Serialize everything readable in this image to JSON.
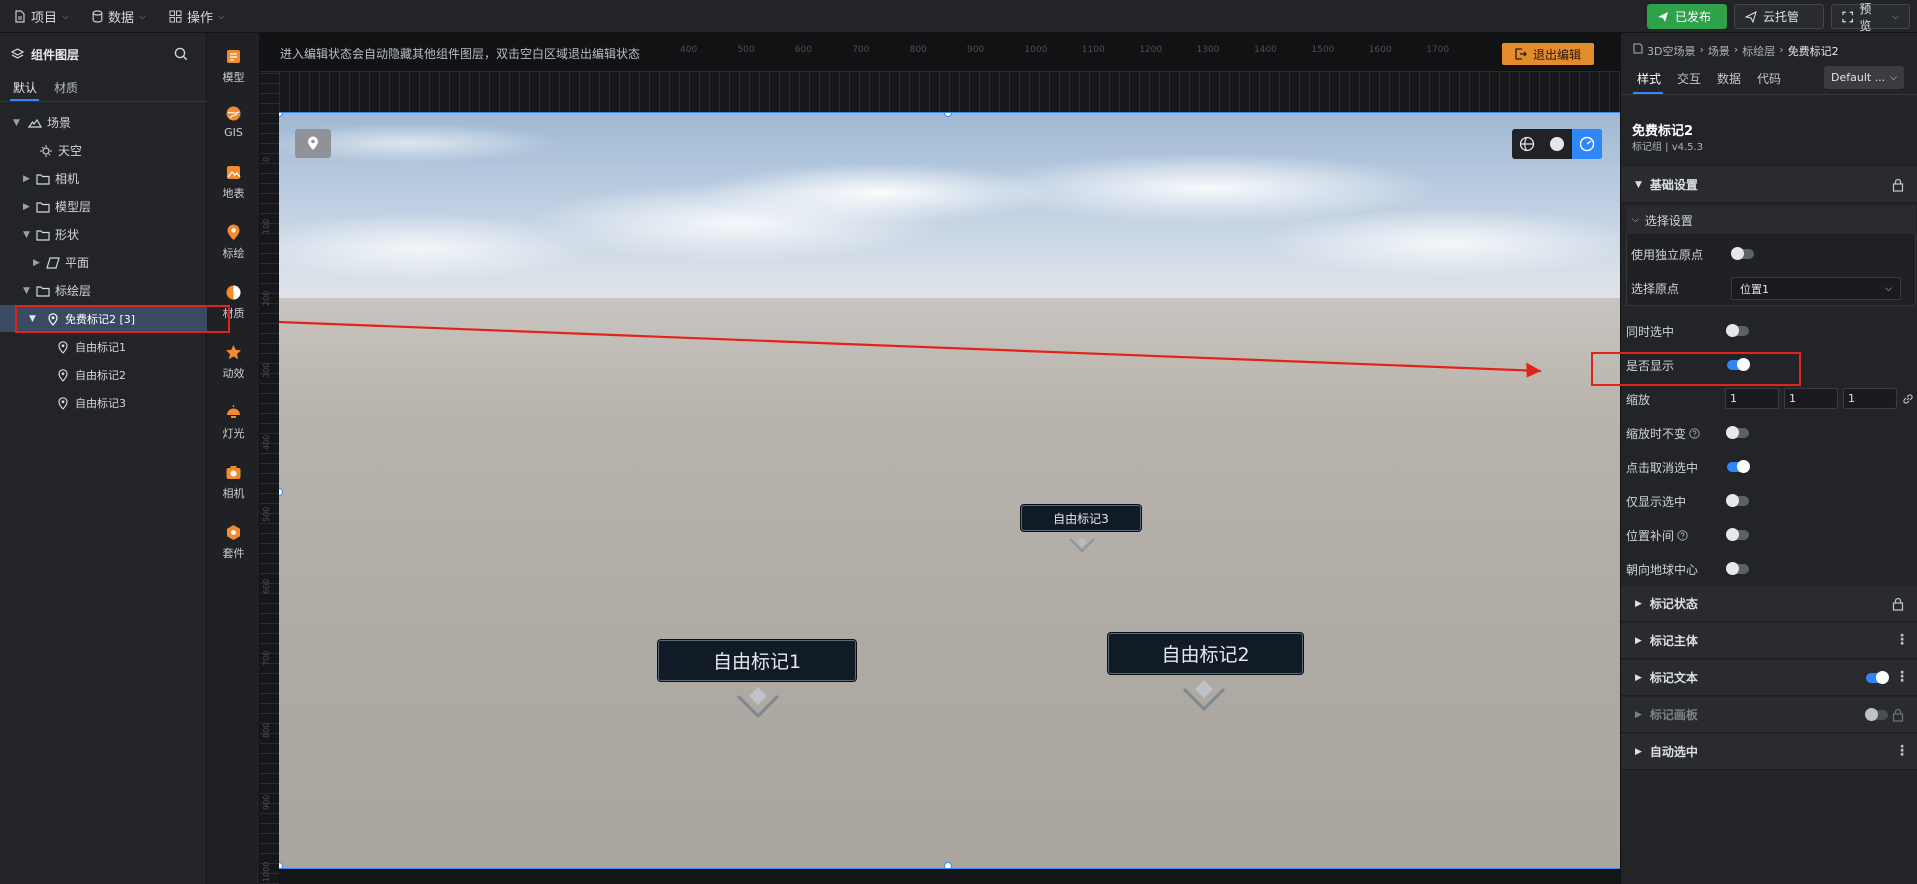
{
  "topbar": {
    "menus": [
      {
        "label": "项目",
        "icon": "file-icon"
      },
      {
        "label": "数据",
        "icon": "database-icon"
      },
      {
        "label": "操作",
        "icon": "grid-icon"
      }
    ],
    "buttons": {
      "publish": "已发布",
      "cloud": "云托管",
      "preview": "预览"
    },
    "colors": {
      "publish": "#2fa14b",
      "accent": "#2f86f6"
    }
  },
  "left_panel": {
    "title": "组件图层",
    "tabs": [
      "默认",
      "材质"
    ],
    "tree": [
      {
        "label": "场景"
      },
      {
        "label": "天空"
      },
      {
        "label": "相机"
      },
      {
        "label": "模型层"
      },
      {
        "label": "形状"
      },
      {
        "label": "平面"
      },
      {
        "label": "标绘层"
      },
      {
        "label": "免费标记2 [3]"
      },
      {
        "label": "自由标记1"
      },
      {
        "label": "自由标记2"
      },
      {
        "label": "自由标记3"
      }
    ]
  },
  "toolbox": {
    "items": [
      {
        "label": "模型",
        "icon": "cube-icon"
      },
      {
        "label": "GIS",
        "icon": "globe-icon"
      },
      {
        "label": "地表",
        "icon": "terrain-icon"
      },
      {
        "label": "标绘",
        "icon": "pin-icon"
      },
      {
        "label": "材质",
        "icon": "material-icon"
      },
      {
        "label": "动效",
        "icon": "star-icon"
      },
      {
        "label": "灯光",
        "icon": "light-icon"
      },
      {
        "label": "相机",
        "icon": "camera-icon"
      },
      {
        "label": "套件",
        "icon": "kit-icon"
      }
    ]
  },
  "canvas": {
    "hint": "进入编辑状态会自动隐藏其他组件图层，双击空白区域退出编辑状态",
    "exit_label": "退出编辑",
    "ruler_top": [
      "400",
      "500",
      "600",
      "700",
      "800",
      "900",
      "1000",
      "1100",
      "1200",
      "1300",
      "1400",
      "1500",
      "1600",
      "1700"
    ],
    "ruler_left": [
      "0",
      "100",
      "200",
      "300",
      "400",
      "500",
      "600",
      "700",
      "800",
      "900",
      "1000"
    ],
    "markers": [
      {
        "label": "自由标记1"
      },
      {
        "label": "自由标记2"
      },
      {
        "label": "自由标记3"
      }
    ]
  },
  "right_panel": {
    "breadcrumb": [
      "3D空场景",
      "场景",
      "标绘层",
      "免费标记2"
    ],
    "tabs": [
      "样式",
      "交互",
      "数据",
      "代码"
    ],
    "theme_select": "Default ...",
    "component_name": "免费标记2",
    "component_subtitle": "标记组 | v4.5.3",
    "basic_section": "基础设置",
    "select_group": "选择设置",
    "props": {
      "use_origin": {
        "label": "使用独立原点",
        "on": false
      },
      "origin": {
        "label": "选择原点",
        "value": "位置1"
      },
      "multi_select": {
        "label": "同时选中",
        "on": false
      },
      "visible": {
        "label": "是否显示",
        "on": true
      },
      "scale": {
        "label": "缩放",
        "values": [
          "1",
          "1",
          "1"
        ]
      },
      "scale_fixed": {
        "label": "缩放时不变",
        "on": false
      },
      "click_deselect": {
        "label": "点击取消选中",
        "on": true
      },
      "show_selected_only": {
        "label": "仅显示选中",
        "on": false
      },
      "interpolate": {
        "label": "位置补间",
        "on": false
      },
      "face_center": {
        "label": "朝向地球中心",
        "on": false
      }
    },
    "sections": [
      {
        "label": "标记状态"
      },
      {
        "label": "标记主体"
      },
      {
        "label": "标记文本"
      },
      {
        "label": "标记画板"
      },
      {
        "label": "自动选中"
      }
    ]
  }
}
